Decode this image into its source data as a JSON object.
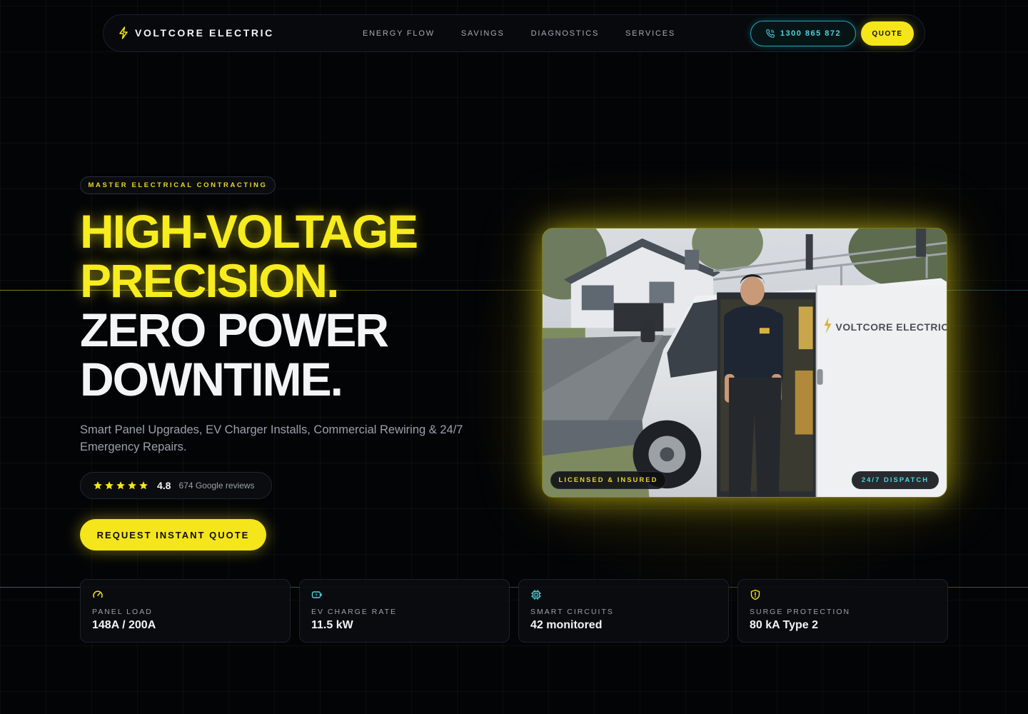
{
  "nav": {
    "brand": "VOLTCORE ELECTRIC",
    "links": [
      "ENERGY FLOW",
      "SAVINGS",
      "DIAGNOSTICS",
      "SERVICES"
    ],
    "phone": "1300 865 872",
    "quote": "QUOTE"
  },
  "hero": {
    "badge": "MASTER ELECTRICAL CONTRACTING",
    "headline_1": "HIGH-VOLTAGE",
    "headline_2": "PRECISION.",
    "headline_3": "ZERO POWER",
    "headline_4": "DOWNTIME.",
    "subtitle": "Smart Panel Upgrades, EV Charger Installs, Commercial Rewiring & 24/7 Emergency Repairs.",
    "rating": {
      "stars": 5,
      "value": "4.8",
      "count": "674 Google reviews"
    },
    "cta": "REQUEST INSTANT QUOTE"
  },
  "photo": {
    "van_text": "VOLTCORE ELECTRIC",
    "tag_left": "LICENSED & INSURED",
    "tag_right": "24/7 DISPATCH"
  },
  "stats": [
    {
      "label": "PANEL LOAD",
      "value": "148A / 200A",
      "icon": "gauge-icon"
    },
    {
      "label": "EV CHARGE RATE",
      "value": "11.5 kW",
      "icon": "battery-charging-icon"
    },
    {
      "label": "SMART CIRCUITS",
      "value": "42 monitored",
      "icon": "chip-icon"
    },
    {
      "label": "SURGE PROTECTION",
      "value": "80 kA Type 2",
      "icon": "shield-alert-icon"
    }
  ],
  "colors": {
    "accent": "#f5e51b",
    "cyan": "#4fd3dd",
    "background": "#030406"
  }
}
